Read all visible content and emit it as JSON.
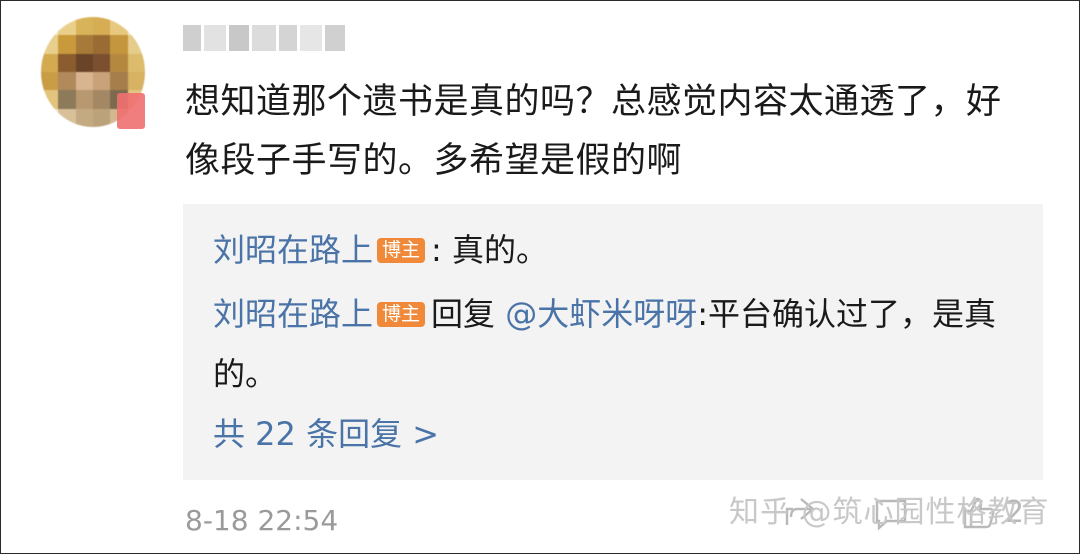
{
  "comment": {
    "text": "想知道那个遗书是真的吗？总感觉内容太通透了，好像段子手写的。多希望是假的啊",
    "timestamp": "8-18 22:54"
  },
  "replies": [
    {
      "author": "刘昭在路上",
      "badge": "博主",
      "prefix": "",
      "mention": "",
      "text": ": 真的。"
    },
    {
      "author": "刘昭在路上",
      "badge": "博主",
      "prefix": "回复 ",
      "mention": "@大虾米呀呀",
      "text": ":平台确认过了，是真的。"
    }
  ],
  "more_replies_label": "共 22 条回复 >",
  "watermark": "知乎 @筑心园性格教育",
  "icons": {
    "share": "share-icon",
    "comment": "comment-icon",
    "like": "like-icon"
  },
  "like_count": "2",
  "colors": {
    "link": "#4a73a8",
    "badge": "#f08a3a",
    "reply_bg": "#f3f3f3",
    "timestamp": "#9a9a9a"
  }
}
